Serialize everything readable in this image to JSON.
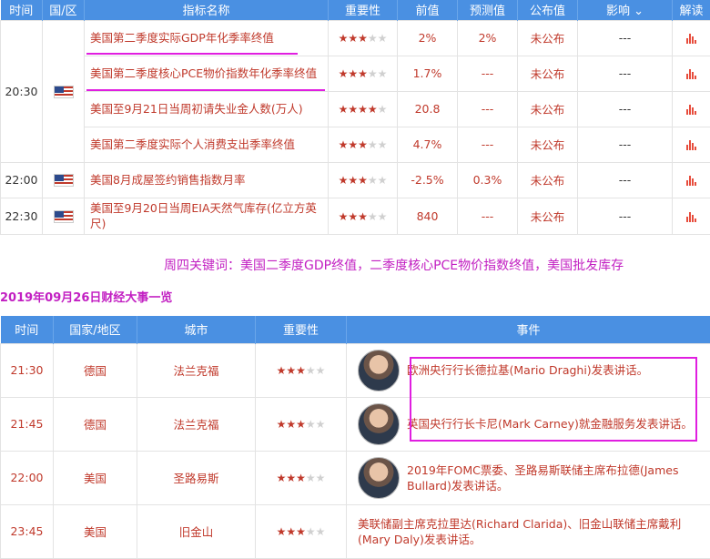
{
  "table1": {
    "headers": [
      "时间",
      "国/区",
      "指标名称",
      "重要性",
      "前值",
      "预测值",
      "公布值",
      "影响",
      "解读"
    ],
    "rows": [
      {
        "time": "20:30",
        "name": "美国第二季度实际GDP年化季率终值",
        "stars": 3,
        "prev": "2%",
        "forecast": "2%",
        "actual": "未公布",
        "impact": "---"
      },
      {
        "time": "",
        "name": "美国第二季度核心PCE物价指数年化季率终值",
        "stars": 3,
        "prev": "1.7%",
        "forecast": "---",
        "actual": "未公布",
        "impact": "---"
      },
      {
        "time": "",
        "name": "美国至9月21日当周初请失业金人数(万人)",
        "stars": 4,
        "prev": "20.8",
        "forecast": "---",
        "actual": "未公布",
        "impact": "---"
      },
      {
        "time": "",
        "name": "美国第二季度实际个人消费支出季率终值",
        "stars": 3,
        "prev": "4.7%",
        "forecast": "---",
        "actual": "未公布",
        "impact": "---"
      },
      {
        "time": "22:00",
        "name": "美国8月成屋签约销售指数月率",
        "stars": 3,
        "prev": "-2.5%",
        "forecast": "0.3%",
        "actual": "未公布",
        "impact": "---"
      },
      {
        "time": "22:30",
        "name": "美国至9月20日当周EIA天然气库存(亿立方英尺)",
        "stars": 3,
        "prev": "840",
        "forecast": "---",
        "actual": "未公布",
        "impact": "---"
      }
    ]
  },
  "keywords": "周四关键词：美国二季度GDP终值，二季度核心PCE物价指数终值，美国批发库存",
  "section_title": "2019年09月26日财经大事一览",
  "table2": {
    "headers": [
      "时间",
      "国家/地区",
      "城市",
      "重要性",
      "事件"
    ],
    "rows": [
      {
        "time": "21:30",
        "country": "德国",
        "city": "法兰克福",
        "stars": 3,
        "event": "欧洲央行行长德拉基(Mario Draghi)发表讲话。"
      },
      {
        "time": "21:45",
        "country": "德国",
        "city": "法兰克福",
        "stars": 3,
        "event": "英国央行行长卡尼(Mark Carney)就金融服务发表讲话。"
      },
      {
        "time": "22:00",
        "country": "美国",
        "city": "圣路易斯",
        "stars": 3,
        "event": "2019年FOMC票委、圣路易斯联储主席布拉德(James Bullard)发表讲话。"
      },
      {
        "time": "23:45",
        "country": "美国",
        "city": "旧金山",
        "stars": 3,
        "event": "美联储副主席克拉里达(Richard Clarida)、旧金山联储主席戴利(Mary Daly)发表讲话。"
      }
    ]
  },
  "colors": {
    "header_bg": "#4a90e2",
    "accent_red": "#c0392b",
    "highlight_magenta": "#e01ee0"
  }
}
